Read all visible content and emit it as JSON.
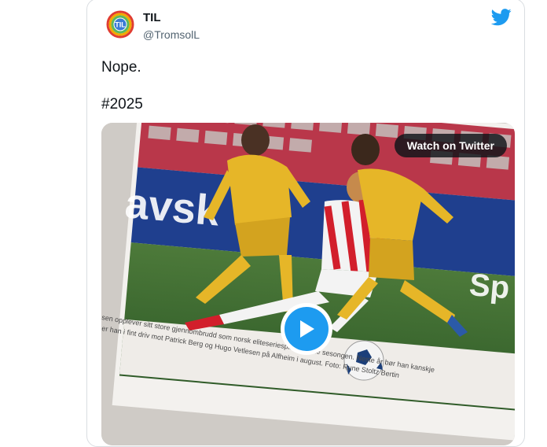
{
  "tweet": {
    "display_name": "TIL",
    "handle": "@TromsolL",
    "text": "Nope.",
    "hashtag": "#2025",
    "video_button_label": "Watch on Twitter"
  },
  "media": {
    "caption_line1": "sen opplever sitt store gjennombrudd som norsk eliteseriespiller denne sesongen. Neste år bør han kanskje",
    "caption_line2": "er han i fint driv mot Patrick Berg og Hugo Vetlesen på Alfheim i august. Foto: Rune Stoltz Bertin",
    "banner_left": "avsk",
    "banner_right": "Sp"
  },
  "colors": {
    "accent": "#1d9bf0",
    "text": "#0f1419",
    "muted": "#536471",
    "bodo_yellow": "#e6b628",
    "tromso_red": "#d21f2b"
  },
  "icons": {
    "brand": "twitter-bird-icon",
    "play": "play-icon",
    "avatar": "til-logo"
  }
}
